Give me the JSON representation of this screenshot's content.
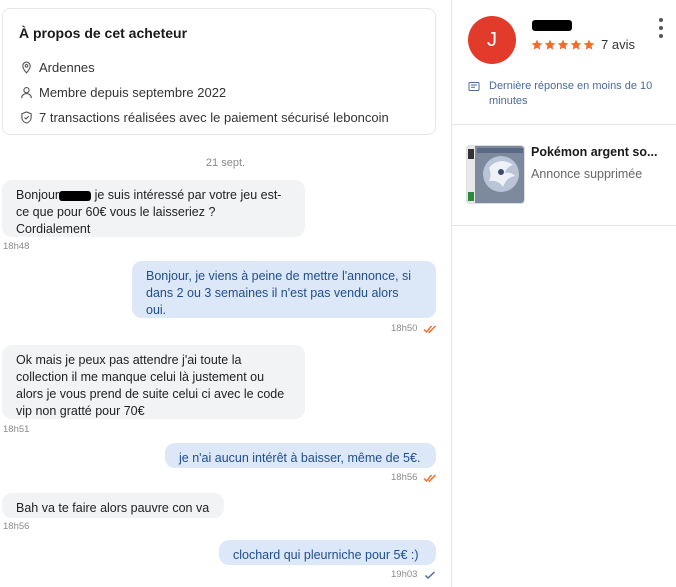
{
  "about": {
    "title": "À propos de cet acheteur",
    "location": "Ardennes",
    "member_since": "Membre depuis septembre 2022",
    "transactions": "7 transactions réalisées avec le paiement sécurisé leboncoin"
  },
  "conversation": {
    "date": "21 sept.",
    "messages": [
      {
        "dir": "in",
        "text_before": "Bonjour",
        "text_after": " je suis intéressé par votre jeu est-ce que pour 60€ vous le laisseriez ? Cordialement",
        "time": "18h48"
      },
      {
        "dir": "out",
        "text": "Bonjour, je viens à peine de mettre l'annonce, si dans 2 ou 3 semaines il n'est pas vendu alors oui.",
        "time": "18h50",
        "status": "read"
      },
      {
        "dir": "in",
        "text": "Ok mais je peux pas attendre j'ai toute la collection il me manque celui là justement ou alors je vous prend de suite celui ci avec le code vip non gratté pour 70€",
        "time": "18h51"
      },
      {
        "dir": "out",
        "text": "je n'ai aucun intérêt à baisser, même de 5€.",
        "time": "18h56",
        "status": "read"
      },
      {
        "dir": "in",
        "text": "Bah va te faire alors pauvre con va",
        "time": "18h56"
      },
      {
        "dir": "out",
        "text": "clochard qui pleurniche pour 5€ :)",
        "time": "19h03",
        "status": "sent"
      }
    ]
  },
  "seller": {
    "avatar_letter": "J",
    "rating": 5,
    "reviews": "7 avis",
    "reply_time": "Dernière réponse en moins de 10 minutes"
  },
  "listing": {
    "title": "Pokémon argent so...",
    "status": "Annonce supprimée"
  },
  "colors": {
    "avatar": "#e23b2c",
    "star": "#f56b2a",
    "out_bubble": "#dce7f7",
    "in_bubble": "#f2f3f5",
    "read_check": "#f56b2a",
    "sent_check": "#4a6a9a"
  }
}
